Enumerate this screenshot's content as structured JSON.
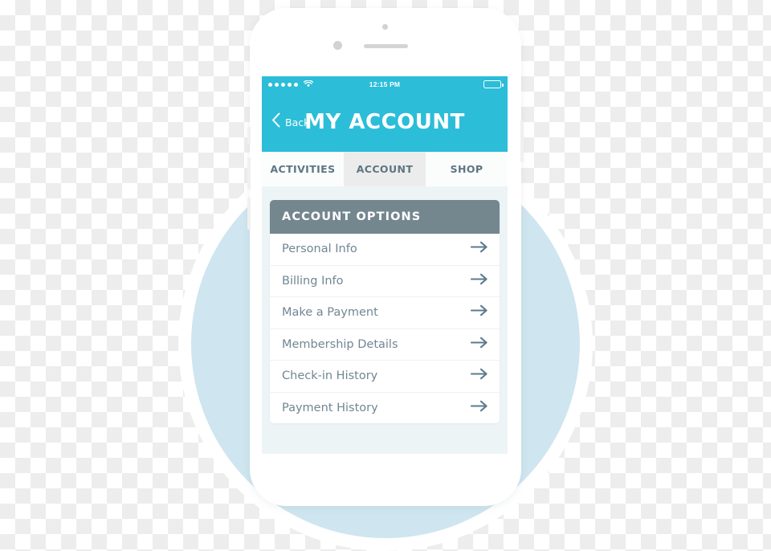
{
  "colors": {
    "accent_teal": "#2cbdd9",
    "card_header_slate": "#74878f",
    "text_slate": "#6f8794",
    "arrow_slate": "#5b7c8c",
    "bg_circle_blue": "#cfe5ef",
    "screen_bg": "#edf4f6",
    "active_tab_bg": "#ececec"
  },
  "phone": {
    "sensor_icon": "proximity-sensor",
    "camera_icon": "front-camera",
    "speaker_icon": "earpiece-speaker"
  },
  "status_bar": {
    "signal_dots": 5,
    "signal_icon": "signal-strength-dots",
    "wifi_icon": "wifi-icon",
    "time": "12:15 PM",
    "battery_icon": "battery-icon"
  },
  "nav_header": {
    "back_icon": "chevron-left-icon",
    "back_label": "Back",
    "title": "MY ACCOUNT"
  },
  "tabs": [
    {
      "label": "ACTIVITIES",
      "active": false
    },
    {
      "label": "ACCOUNT",
      "active": true
    },
    {
      "label": "SHOP",
      "active": false
    }
  ],
  "card": {
    "header": "ACCOUNT  OPTIONS",
    "options": [
      {
        "label": "Personal Info",
        "arrow_icon": "arrow-right-icon"
      },
      {
        "label": "Billing Info",
        "arrow_icon": "arrow-right-icon"
      },
      {
        "label": "Make a Payment",
        "arrow_icon": "arrow-right-icon"
      },
      {
        "label": "Membership Details",
        "arrow_icon": "arrow-right-icon"
      },
      {
        "label": "Check-in History",
        "arrow_icon": "arrow-right-icon"
      },
      {
        "label": "Payment History",
        "arrow_icon": "arrow-right-icon"
      }
    ]
  }
}
